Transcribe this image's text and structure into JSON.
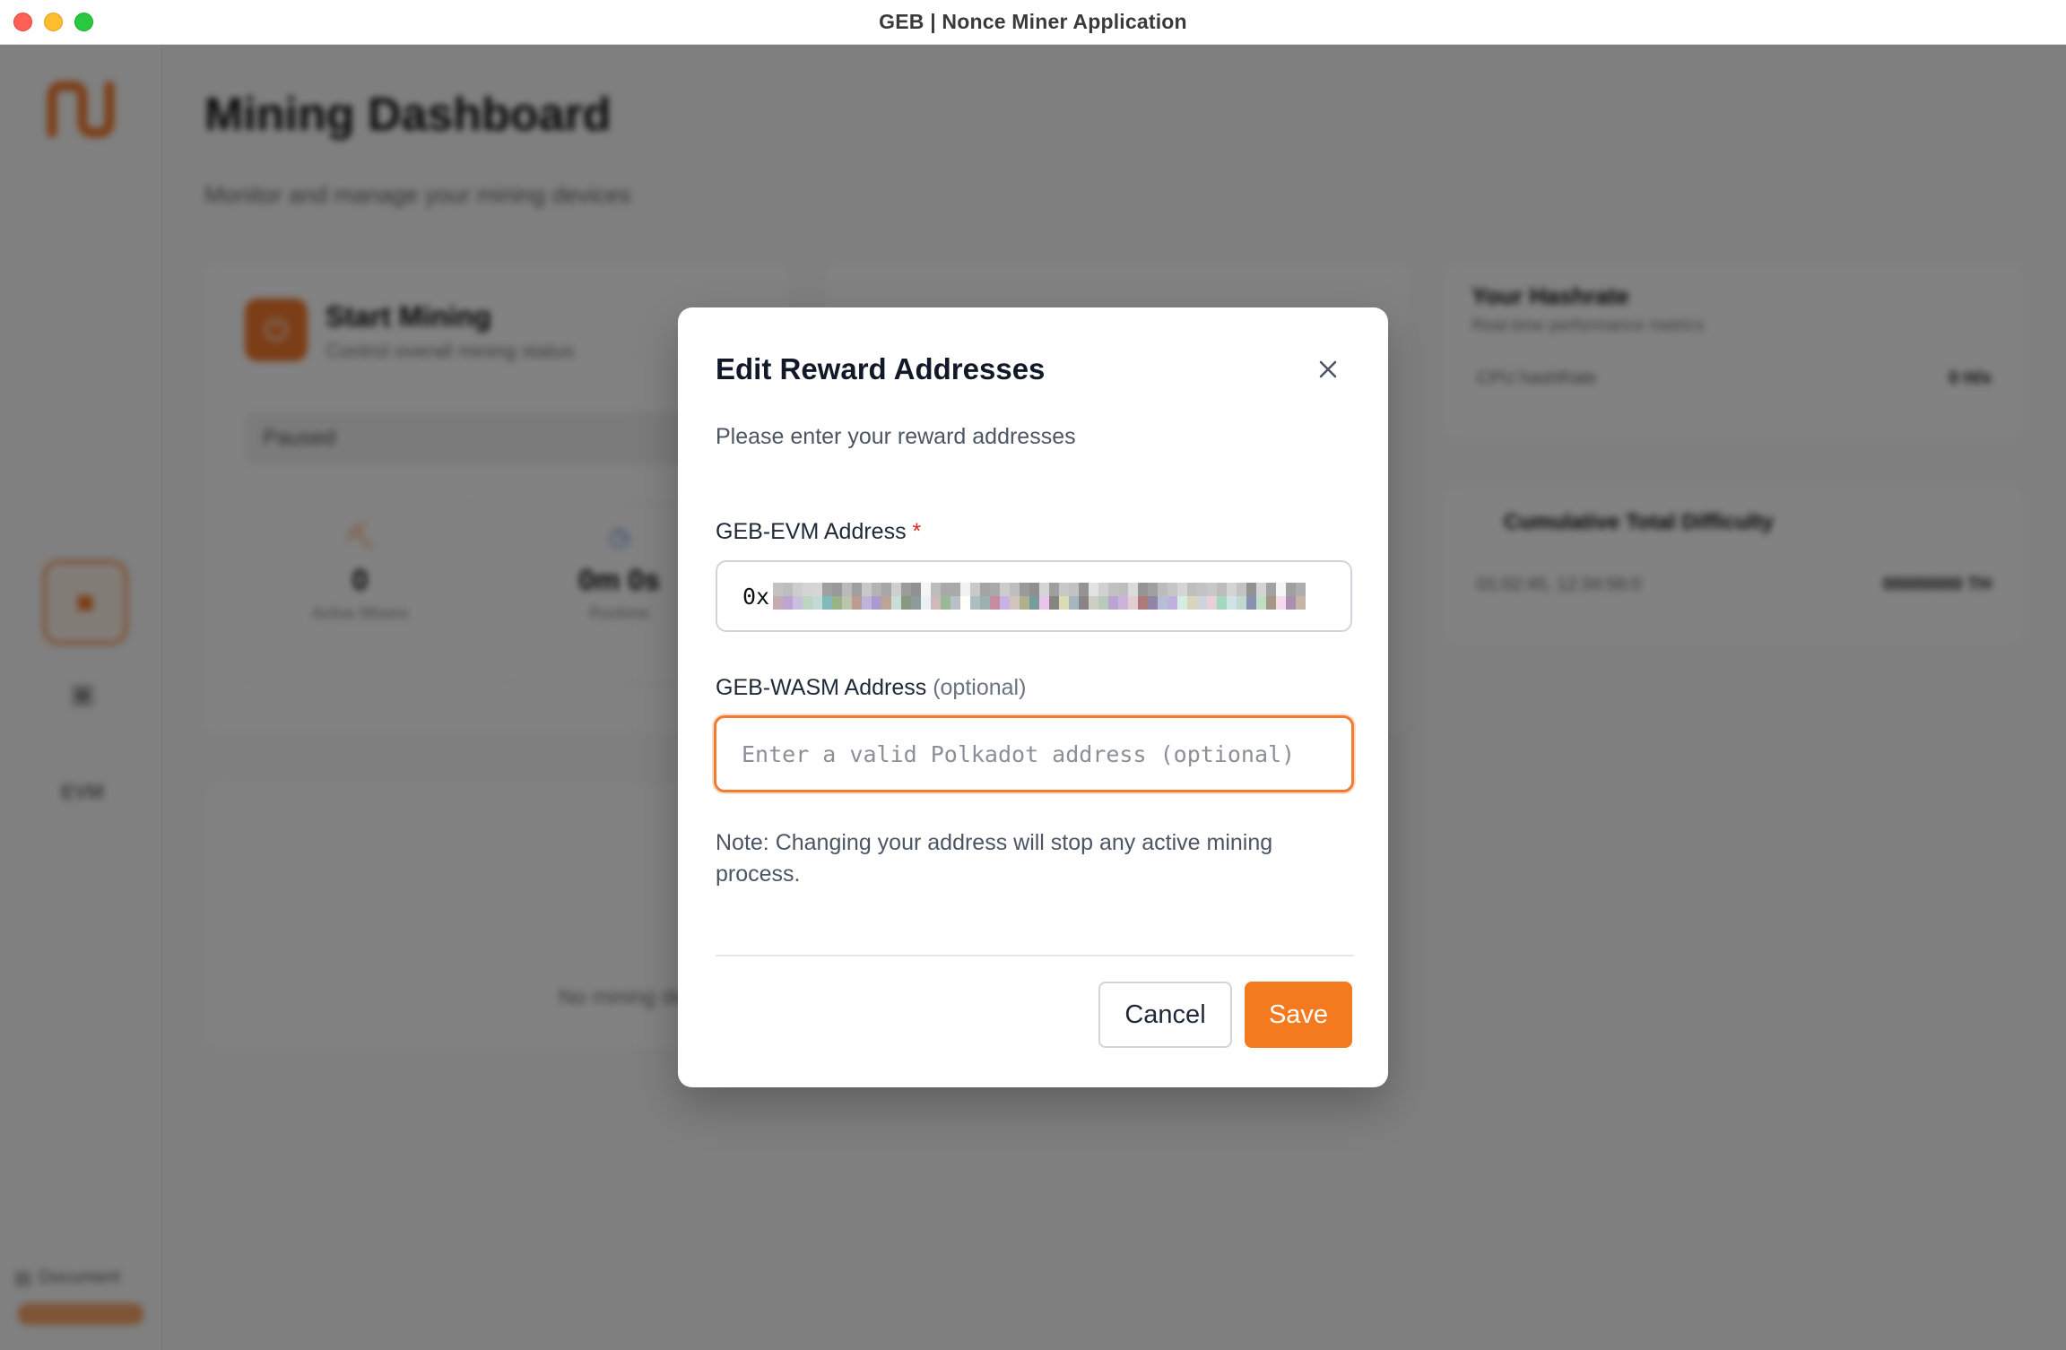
{
  "window": {
    "title": "GEB | Nonce Miner Application"
  },
  "background": {
    "dashboard_title": "Mining Dashboard",
    "dashboard_subtitle": "Monitor and manage your mining devices",
    "start_card": {
      "title": "Start Mining",
      "subtitle": "Control overall mining status",
      "status_chip": "Paused",
      "stats": [
        {
          "value": "0",
          "label": "Active Miners"
        },
        {
          "value": "0m 0s",
          "label": "Runtime"
        }
      ]
    },
    "hashrate_card": {
      "title": "Your Hashrate",
      "subtitle": "Real-time performance metrics",
      "rows": [
        {
          "label": "CPU hashRate",
          "value": "0 H/s"
        }
      ]
    },
    "difficulty_card": {
      "title": "Cumulative Total Difficulty",
      "rows": [
        {
          "label": "01:02:45, 12:34:56:0",
          "value": "00000000 TH"
        }
      ]
    },
    "devices_card": {
      "empty_text": "No mining devices"
    },
    "sidebar": {
      "docs_label": "Document",
      "items": [
        "dashboard",
        "devices",
        "EVM"
      ]
    }
  },
  "modal": {
    "title": "Edit Reward Addresses",
    "description": "Please enter your reward addresses",
    "evm": {
      "label": "GEB-EVM Address",
      "required_mark": "*",
      "value_prefix": "0x"
    },
    "wasm": {
      "label": "GEB-WASM Address",
      "optional_text": "(optional)",
      "value": "",
      "placeholder": "Enter a valid Polkadot address (optional)"
    },
    "note": "Note: Changing your address will stop any active mining process.",
    "buttons": {
      "cancel": "Cancel",
      "save": "Save"
    },
    "close_icon": "x-icon"
  },
  "colors": {
    "accent": "#f37a1f",
    "overlay": "rgba(0,0,0,0.49)"
  }
}
